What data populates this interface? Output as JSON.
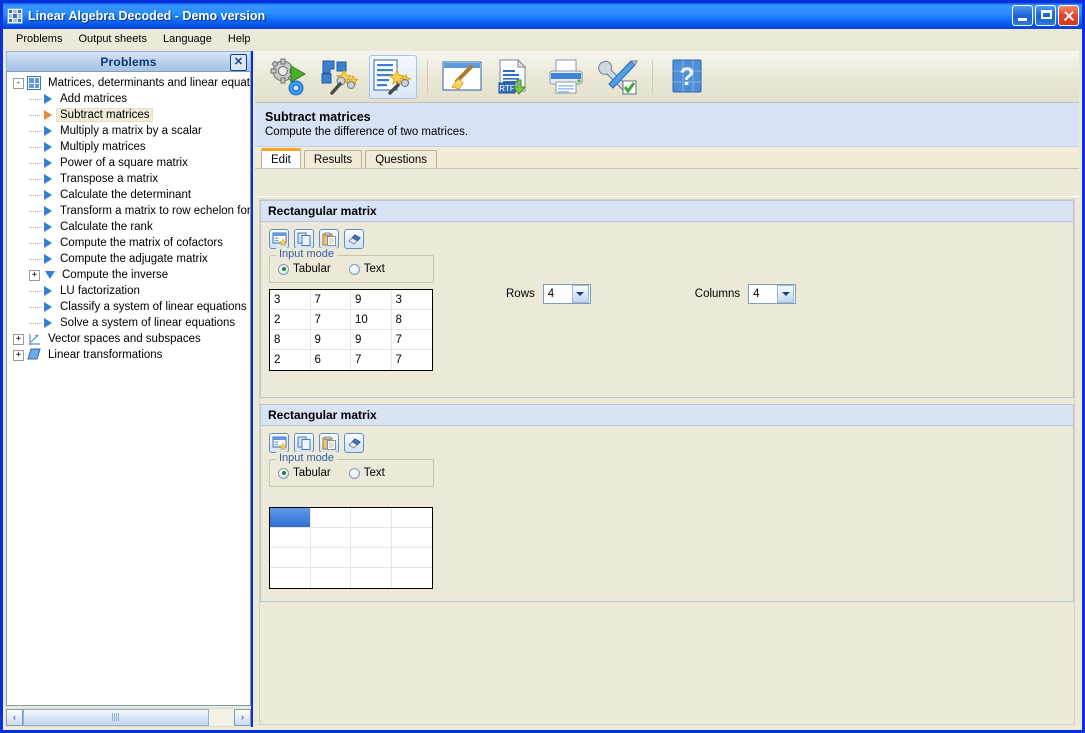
{
  "window": {
    "title": "Linear Algebra Decoded - Demo version",
    "icon": "grid-app-icon",
    "buttons": {
      "minimize": "Minimize",
      "maximize": "Maximize",
      "close": "Close"
    }
  },
  "menubar": {
    "items": [
      "Problems",
      "Output sheets",
      "Language",
      "Help"
    ]
  },
  "sidebar": {
    "title": "Problems",
    "close_label": "✕",
    "tree": [
      {
        "label": "Matrices, determinants and linear equatio",
        "icon": "matrices-grid-icon",
        "level": 0,
        "expander": "-",
        "selected": false
      },
      {
        "label": "Add matrices",
        "icon": "blue-triangle-icon",
        "level": 1,
        "expander": "",
        "selected": false
      },
      {
        "label": "Subtract matrices",
        "icon": "orange-triangle-icon",
        "level": 1,
        "expander": "",
        "selected": true
      },
      {
        "label": "Multiply a matrix by a scalar",
        "icon": "blue-triangle-icon",
        "level": 1,
        "expander": "",
        "selected": false
      },
      {
        "label": "Multiply matrices",
        "icon": "blue-triangle-icon",
        "level": 1,
        "expander": "",
        "selected": false
      },
      {
        "label": "Power of a square matrix",
        "icon": "blue-triangle-icon",
        "level": 1,
        "expander": "",
        "selected": false
      },
      {
        "label": "Transpose a matrix",
        "icon": "blue-triangle-icon",
        "level": 1,
        "expander": "",
        "selected": false
      },
      {
        "label": "Calculate the determinant",
        "icon": "blue-triangle-icon",
        "level": 1,
        "expander": "",
        "selected": false
      },
      {
        "label": "Transform a matrix to row echelon for",
        "icon": "blue-triangle-icon",
        "level": 1,
        "expander": "",
        "selected": false
      },
      {
        "label": "Calculate the rank",
        "icon": "blue-triangle-icon",
        "level": 1,
        "expander": "",
        "selected": false
      },
      {
        "label": "Compute the matrix of cofactors",
        "icon": "blue-triangle-icon",
        "level": 1,
        "expander": "",
        "selected": false
      },
      {
        "label": "Compute the adjugate matrix",
        "icon": "blue-triangle-icon",
        "level": 1,
        "expander": "",
        "selected": false
      },
      {
        "label": "Compute the inverse",
        "icon": "blue-triangle-down-icon",
        "level": 1,
        "expander": "+",
        "selected": false
      },
      {
        "label": "LU factorization",
        "icon": "blue-triangle-icon",
        "level": 1,
        "expander": "",
        "selected": false
      },
      {
        "label": "Classify a system of linear equations",
        "icon": "blue-triangle-icon",
        "level": 1,
        "expander": "",
        "selected": false
      },
      {
        "label": "Solve a system of linear equations",
        "icon": "blue-triangle-icon",
        "level": 1,
        "expander": "",
        "selected": false
      },
      {
        "label": "Vector spaces and subspaces",
        "icon": "axes-icon",
        "level": 0,
        "expander": "+",
        "selected": false
      },
      {
        "label": "Linear transformations",
        "icon": "parallelogram-icon",
        "level": 0,
        "expander": "+",
        "selected": false
      }
    ],
    "scrollbar": {
      "left_arrow": "‹",
      "right_arrow": "›"
    }
  },
  "toolbar": {
    "buttons": [
      {
        "name": "solve-problem-icon",
        "label": "Solve problem"
      },
      {
        "name": "generate-problems-icon",
        "label": "Generate problems"
      },
      {
        "name": "generate-worksheet-icon",
        "label": "Generate worksheet"
      },
      {
        "name": "clear-icon",
        "label": "Clear"
      },
      {
        "name": "export-rtf-icon",
        "label": "Export to RTF"
      },
      {
        "name": "print-icon",
        "label": "Print"
      },
      {
        "name": "options-icon",
        "label": "Options"
      },
      {
        "name": "help-icon",
        "label": "Help"
      }
    ]
  },
  "problem": {
    "title": "Subtract matrices",
    "subtitle": "Compute the difference of two matrices."
  },
  "tabs": [
    {
      "label": "Edit",
      "active": true
    },
    {
      "label": "Results",
      "active": false
    },
    {
      "label": "Questions",
      "active": false
    }
  ],
  "matrix_a": {
    "group_title": "Rectangular matrix",
    "tools": [
      {
        "name": "generate-matrix-icon",
        "label": "Generate matrix"
      },
      {
        "name": "copy-icon",
        "label": "Copy"
      },
      {
        "name": "paste-icon",
        "label": "Paste"
      },
      {
        "name": "eraser-icon",
        "label": "Clear matrix"
      }
    ],
    "input_mode": {
      "legend": "Input mode",
      "options": [
        {
          "label": "Tabular",
          "selected": true
        },
        {
          "label": "Text",
          "selected": false
        }
      ]
    },
    "rows": {
      "label": "Rows",
      "value": "4"
    },
    "columns": {
      "label": "Columns",
      "value": "4"
    },
    "cells": [
      [
        "3",
        "7",
        "9",
        "3"
      ],
      [
        "2",
        "7",
        "10",
        "8"
      ],
      [
        "8",
        "9",
        "9",
        "7"
      ],
      [
        "2",
        "6",
        "7",
        "7"
      ]
    ],
    "selected_cell": null
  },
  "matrix_b": {
    "group_title": "Rectangular matrix",
    "tools": [
      {
        "name": "generate-matrix-icon",
        "label": "Generate matrix"
      },
      {
        "name": "copy-icon",
        "label": "Copy"
      },
      {
        "name": "paste-icon",
        "label": "Paste"
      },
      {
        "name": "eraser-icon",
        "label": "Clear matrix"
      }
    ],
    "input_mode": {
      "legend": "Input mode",
      "options": [
        {
          "label": "Tabular",
          "selected": true
        },
        {
          "label": "Text",
          "selected": false
        }
      ]
    },
    "cells": [
      [
        "",
        "",
        "",
        ""
      ],
      [
        "",
        "",
        "",
        ""
      ],
      [
        "",
        "",
        "",
        ""
      ],
      [
        "",
        "",
        "",
        ""
      ]
    ],
    "selected_cell": [
      0,
      0
    ]
  },
  "colors": {
    "title_blue": "#0831d9",
    "panel_header": "#d8e3f4",
    "desc_bg": "#d7e3f4",
    "window_bg": "#ece9d8",
    "accent_orange": "#f5a623",
    "selection_blue": "#2f6fd0"
  }
}
